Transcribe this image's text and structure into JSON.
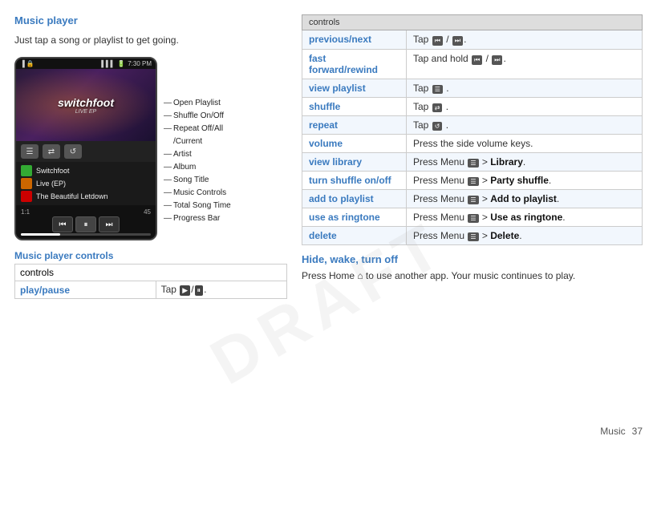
{
  "page": {
    "title": "Music player",
    "description": "Just tap a song or playlist to get going.",
    "footer_label": "Music",
    "footer_page": "37"
  },
  "phone": {
    "status_time": "7:30 PM",
    "album_artist": "Switchfoot",
    "album_name": "Live (EP)",
    "song_title": "The Beautiful Letdown",
    "album_art_text": "switchfoot",
    "album_art_subtitle": "LIVE EP",
    "time_current": "1:1",
    "time_total": "45"
  },
  "annotations": [
    "Open Playlist",
    "Shuffle On/Off",
    "Repeat Off/All /Current",
    "Artist",
    "Album",
    "Song Title",
    "Music Controls",
    "Total Song Time",
    "Progress Bar"
  ],
  "left_table": {
    "header": "controls",
    "rows": [
      {
        "key": "play/pause",
        "value": "Tap ▶/⏸."
      }
    ]
  },
  "right_table": {
    "header": "controls",
    "rows": [
      {
        "key": "previous/next",
        "value": "Tap ⏮ / ⏭."
      },
      {
        "key": "fast forward/rewind",
        "value": "Tap and hold ⏮ / ⏭."
      },
      {
        "key": "view playlist",
        "value": "Tap ☰ ."
      },
      {
        "key": "shuffle",
        "value": "Tap ⇄ ."
      },
      {
        "key": "repeat",
        "value": "Tap ↺ ."
      },
      {
        "key": "volume",
        "value": "Press the side volume keys."
      },
      {
        "key": "view library",
        "value": "Press Menu ☰ > Library."
      },
      {
        "key": "turn shuffle on/off",
        "value": "Press Menu ☰ > Party shuffle."
      },
      {
        "key": "add to playlist",
        "value": "Press Menu ☰ > Add to playlist."
      },
      {
        "key": "use as ringtone",
        "value": "Press Menu ☰ > Use as ringtone."
      },
      {
        "key": "delete",
        "value": "Press Menu ☰ > Delete."
      }
    ]
  },
  "hide_section": {
    "title": "Hide, wake, turn off",
    "text": "Press Home 🏠 to use another app. Your music continues to play."
  }
}
